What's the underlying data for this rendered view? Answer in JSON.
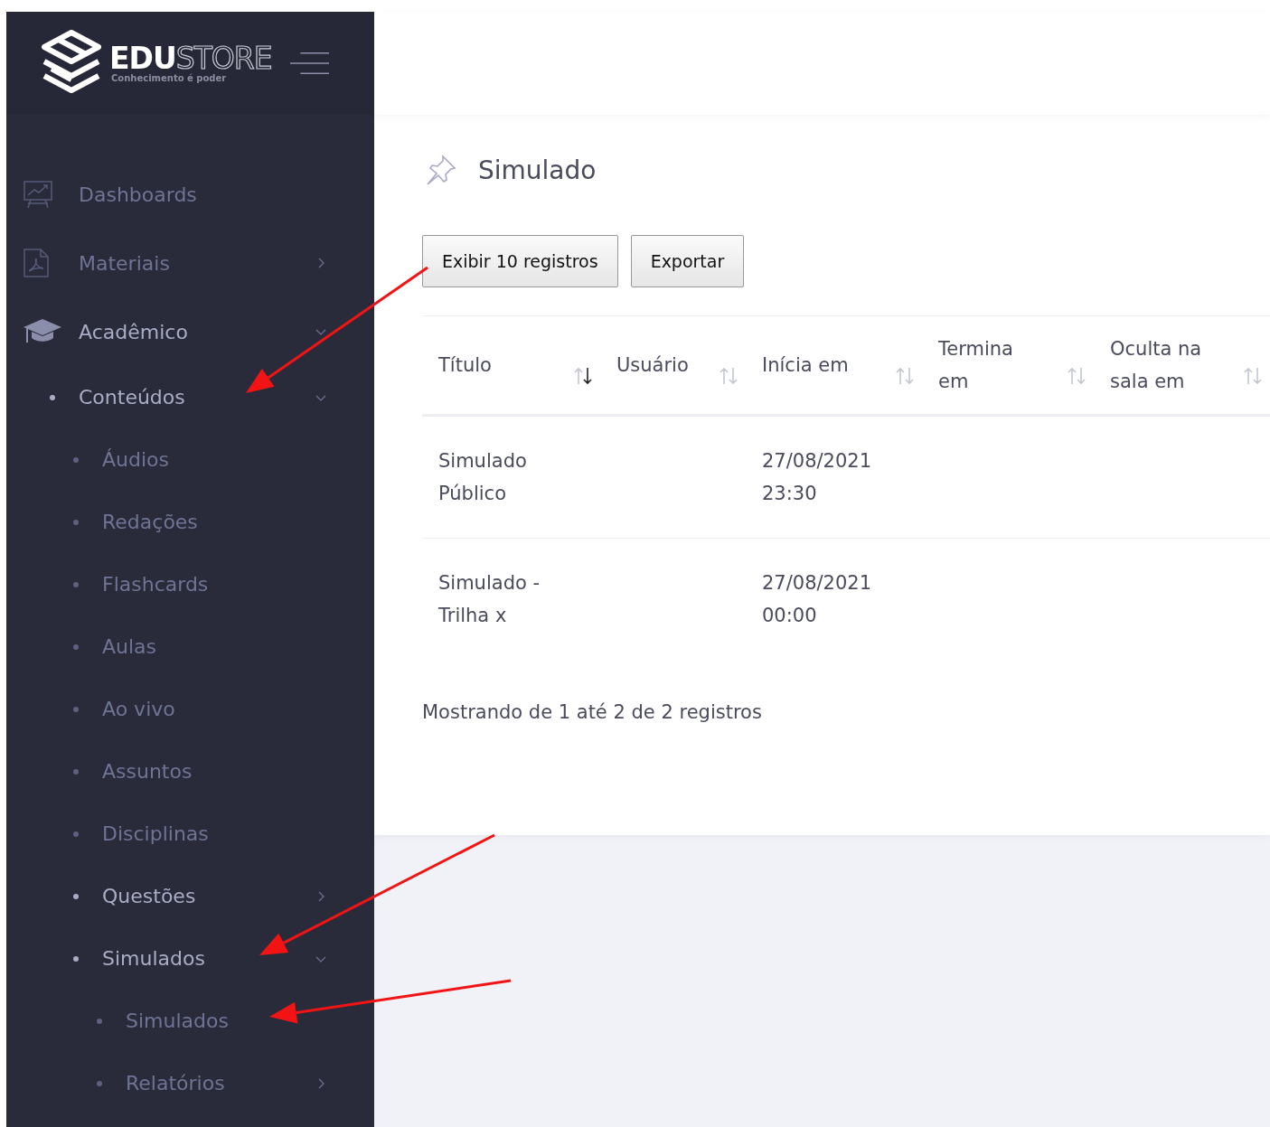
{
  "logo": {
    "name_bold": "EDU",
    "name_outline": "STORE",
    "tagline": "Conhecimento é poder"
  },
  "sidebar": {
    "items": [
      {
        "label": "Dashboards",
        "highlighted": false
      },
      {
        "label": "Materiais",
        "highlighted": false,
        "expanded": false
      },
      {
        "label": "Acadêmico",
        "highlighted": true,
        "expanded": true,
        "children": [
          {
            "label": "Conteúdos",
            "highlighted": true,
            "expanded": true,
            "children": [
              {
                "label": "Áudios",
                "highlighted": false
              },
              {
                "label": "Redações",
                "highlighted": false
              },
              {
                "label": "Flashcards",
                "highlighted": false
              },
              {
                "label": "Aulas",
                "highlighted": false
              },
              {
                "label": "Ao vivo",
                "highlighted": false
              },
              {
                "label": "Assuntos",
                "highlighted": false
              },
              {
                "label": "Disciplinas",
                "highlighted": false
              },
              {
                "label": "Questões",
                "highlighted": true,
                "expanded": false
              },
              {
                "label": "Simulados",
                "highlighted": true,
                "expanded": true,
                "children": [
                  {
                    "label": "Simulados",
                    "highlighted": false
                  },
                  {
                    "label": "Relatórios",
                    "highlighted": false,
                    "expanded": false
                  }
                ]
              }
            ]
          }
        ]
      }
    ]
  },
  "page": {
    "title": "Simulado"
  },
  "buttons": [
    "Exibir 10 registros",
    "Exportar"
  ],
  "table": {
    "columns": [
      {
        "label": "Título",
        "sorted": true
      },
      {
        "label": "Usuário",
        "sorted": false
      },
      {
        "label": "Inícia em",
        "sorted": false
      },
      {
        "label": "Termina em",
        "sorted": false
      },
      {
        "label": "Oculta na sala em",
        "sorted": false
      }
    ],
    "rows": [
      [
        "Simulado Público",
        "",
        "27/08/2021 23:30",
        "",
        ""
      ],
      [
        "Simulado - Trilha x",
        "",
        "27/08/2021 00:00",
        "",
        ""
      ]
    ]
  },
  "footer": "Mostrando de 1 até 2 de 2 registros"
}
